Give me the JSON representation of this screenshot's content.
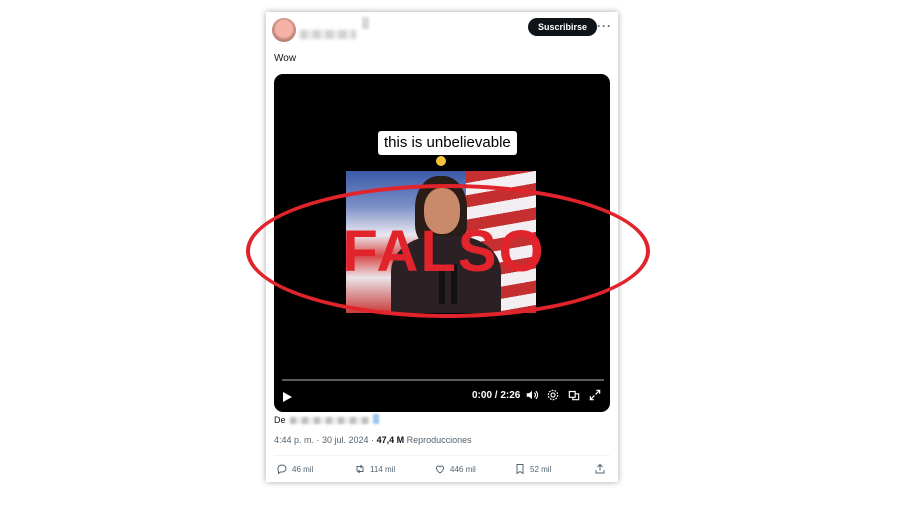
{
  "post": {
    "text": "Wow",
    "subscribe_label": "Suscribirse",
    "more_label": "···",
    "video_caption": "this is unbelievable",
    "overlay_stamp": "FALSO",
    "from_prefix": "De",
    "timestamp": "4:44 p. m. · 30 jul. 2024 · ",
    "views_count": "47,4 M",
    "views_label": " Reproducciones",
    "video_time": "0:00 / 2:26"
  },
  "actions": [
    {
      "icon": "reply-icon",
      "count": "46 mil"
    },
    {
      "icon": "retweet-icon",
      "count": "114 mil"
    },
    {
      "icon": "like-icon",
      "count": "446 mil"
    },
    {
      "icon": "bookmark-icon",
      "count": "52 mil"
    },
    {
      "icon": "share-icon",
      "count": ""
    }
  ],
  "colors": {
    "accent_stamp": "#e1242b",
    "subscribe_bg": "#0f1419",
    "muted_text": "#536471"
  }
}
